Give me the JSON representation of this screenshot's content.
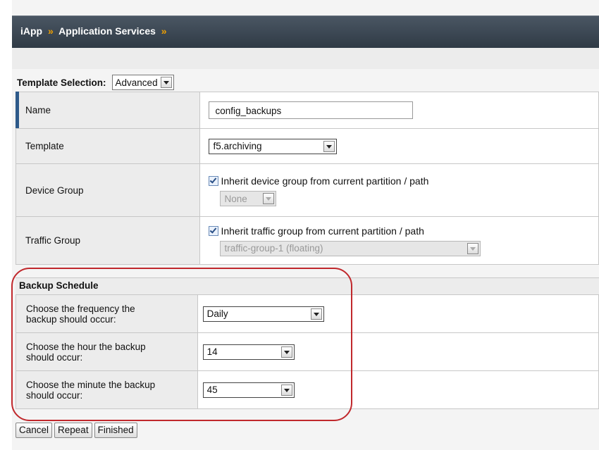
{
  "breadcrumb": {
    "item1": "iApp",
    "sep": "»",
    "item2": "Application Services",
    "sep2": "»"
  },
  "template_selection": {
    "label": "Template Selection:",
    "value": "Advanced"
  },
  "form": {
    "name": {
      "label": "Name",
      "value": "config_backups"
    },
    "template": {
      "label": "Template",
      "value": "f5.archiving"
    },
    "device_group": {
      "label": "Device Group",
      "checkbox_label": "Inherit device group from current partition / path",
      "select_value": "None"
    },
    "traffic_group": {
      "label": "Traffic Group",
      "checkbox_label": "Inherit traffic group from current partition / path",
      "select_value": "traffic-group-1 (floating)"
    }
  },
  "backup_schedule": {
    "title": "Backup Schedule",
    "rows": [
      {
        "label_l1": "Choose the frequency the",
        "label_l2": "backup should occur:",
        "value": "Daily"
      },
      {
        "label_l1": "Choose the hour the backup",
        "label_l2": "should occur:",
        "value": "14"
      },
      {
        "label_l1": "Choose the minute the backup",
        "label_l2": "should occur:",
        "value": "45"
      }
    ]
  },
  "buttons": {
    "cancel": "Cancel",
    "repeat": "Repeat",
    "finished": "Finished"
  },
  "colors": {
    "highlight": "#c0282c",
    "titlebar": "#3a4652",
    "crumb_separator": "#f0a000",
    "name_row_bar": "#2e5a8a"
  }
}
